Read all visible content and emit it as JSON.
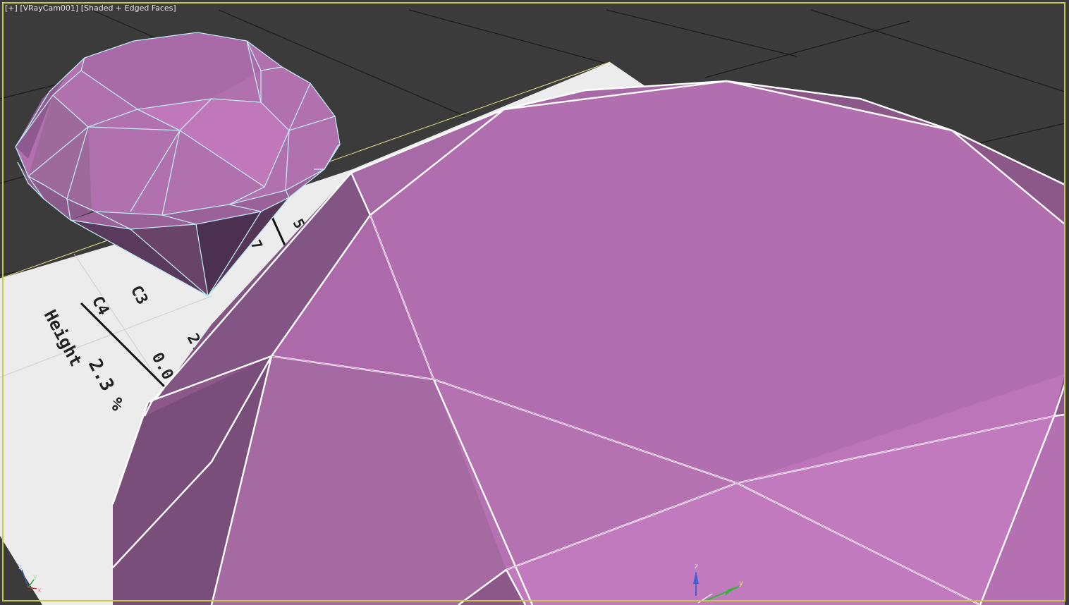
{
  "viewport": {
    "menu_plus": "[+]",
    "camera": "[VRayCam001]",
    "shading": "[Shaded + Edged Faces]"
  },
  "paper": {
    "texts": [
      "C3",
      "C4",
      "Height",
      "2.2",
      "0.0",
      "2.3 %",
      "7",
      "5"
    ]
  },
  "gizmo": {
    "left": {
      "z": "z",
      "y": "y",
      "x": "x"
    },
    "center": {
      "z": "z",
      "y": "y",
      "x": "x"
    }
  },
  "colors": {
    "viewport_bg": "#3a3a3a",
    "grid_line": "#4a4a4a",
    "frame_border": "#c8c84a",
    "gem_top": "#b06fae",
    "gem_side": "#7e4f80",
    "gem_dark": "#5a3a5c",
    "edge_small": "#bfe9f2",
    "edge_large": "#ffffff",
    "paper": "#ececec"
  }
}
